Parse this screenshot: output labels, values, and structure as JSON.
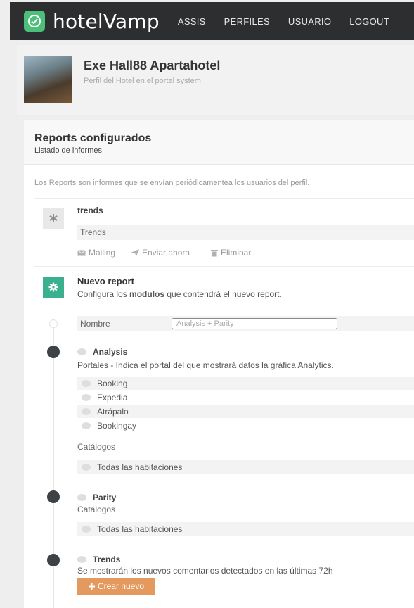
{
  "header": {
    "brand": "hotelVamp",
    "nav": [
      "ASSIS",
      "PERFILES",
      "USUARIO",
      "LOGOUT"
    ]
  },
  "hotel": {
    "name": "Exe Hall88 Apartahotel",
    "subtitle": "Perfil del Hotel en el portal system"
  },
  "reports": {
    "title": "Reports configurados",
    "subtitle": "Listado de informes",
    "intro": "Los Reports son informes que se envían periódicamentea los usuarios del perfil.",
    "existing": {
      "name": "trends",
      "module": "Trends",
      "actions": {
        "mailing": "Mailing",
        "send_now": "Enviar ahora",
        "delete": "Eliminar"
      }
    }
  },
  "new_report": {
    "title": "Nuevo report",
    "desc_prefix": "Configura los ",
    "desc_bold": "modulos",
    "desc_suffix": " que contendrá el nuevo report.",
    "name_label": "Nombre",
    "name_value": "Analysis + Parity",
    "analysis": {
      "title": "Analysis",
      "desc": "Portales - Indica el portal del que mostrará datos la gráfica Analytics.",
      "portals": [
        "Booking",
        "Expedia",
        "Atrápalo",
        "Bookingay"
      ],
      "catalog_label": "Catálogos",
      "catalog_option": "Todas las habitaciones"
    },
    "parity": {
      "title": "Parity",
      "catalog_label": "Catálogos",
      "catalog_option": "Todas las habitaciones"
    },
    "trends": {
      "title": "Trends",
      "desc": "Se mostrarán los nuevos comentarios detectados en las últimas 72h"
    },
    "create_button": "Crear nuevo"
  },
  "colors": {
    "topbar": "#2c2e30",
    "logo": "#4cbf7a",
    "new_report_icon": "#3ab08e",
    "create_button": "#e49a5e"
  },
  "icons": {
    "logo": "check-circle-icon",
    "existing_report": "asterisk-icon",
    "new_report": "gear-icon",
    "mailing": "envelope-icon",
    "send_now": "paper-plane-icon",
    "delete": "trash-icon",
    "create": "plus-icon"
  }
}
